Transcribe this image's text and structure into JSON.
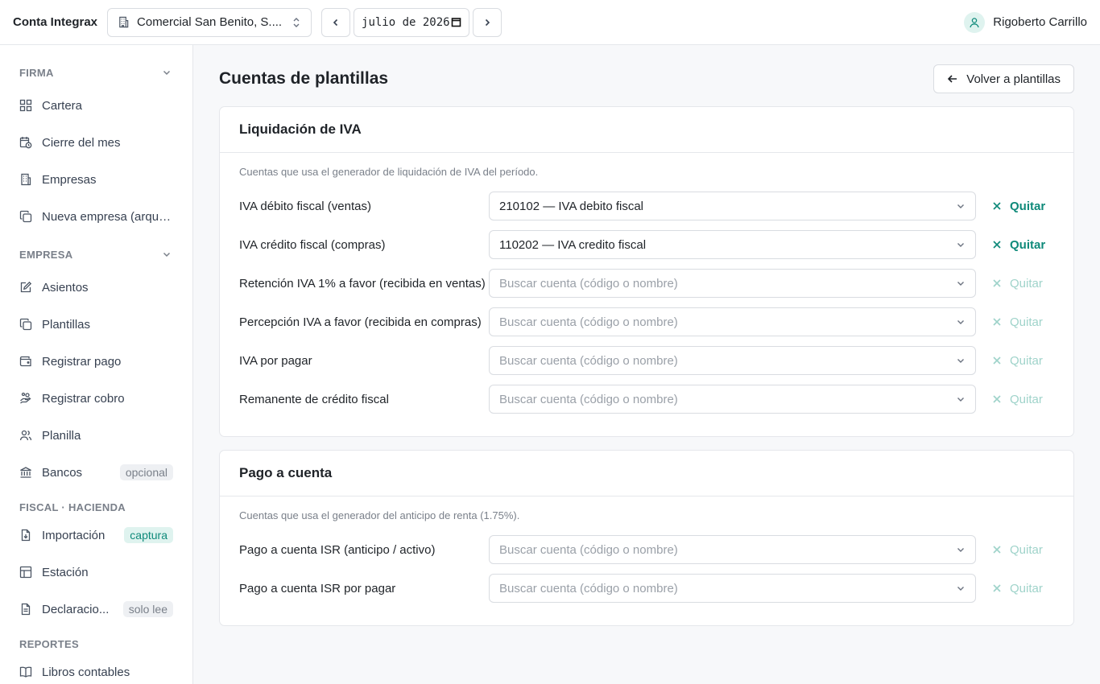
{
  "topbar": {
    "app_title": "Conta Integrax",
    "company": "Comercial San Benito, S....",
    "period": "julio de 2026",
    "user_name": "Rigoberto Carrillo"
  },
  "sidebar": {
    "sections": [
      {
        "title": "FIRMA",
        "collapsible": true,
        "items": [
          {
            "label": "Cartera",
            "icon": "grid-icon"
          },
          {
            "label": "Cierre del mes",
            "icon": "calendar-clock-icon"
          },
          {
            "label": "Empresas",
            "icon": "building-icon"
          },
          {
            "label": "Nueva empresa (arque...",
            "icon": "copy-icon"
          }
        ]
      },
      {
        "title": "EMPRESA",
        "collapsible": true,
        "items": [
          {
            "label": "Asientos",
            "icon": "edit-icon"
          },
          {
            "label": "Plantillas",
            "icon": "copy-icon"
          },
          {
            "label": "Registrar pago",
            "icon": "wallet-icon"
          },
          {
            "label": "Registrar cobro",
            "icon": "hand-coins-icon"
          },
          {
            "label": "Planilla",
            "icon": "users-icon"
          },
          {
            "label": "Bancos",
            "icon": "bank-icon",
            "badge": "opcional"
          }
        ]
      },
      {
        "title": "FISCAL · HACIENDA",
        "collapsible": false,
        "items": [
          {
            "label": "Importación",
            "icon": "file-import-icon",
            "badge": "captura",
            "badge_color": "#0f8a7a"
          },
          {
            "label": "Estación",
            "icon": "table-icon"
          },
          {
            "label": "Declaracio...",
            "icon": "file-text-icon",
            "badge": "solo lee"
          }
        ]
      },
      {
        "title": "REPORTES",
        "collapsible": false,
        "items": [
          {
            "label": "Libros contables",
            "icon": "book-icon"
          }
        ]
      }
    ]
  },
  "main": {
    "title": "Cuentas de plantillas",
    "back_label": "Volver a plantillas",
    "remove_label": "Quitar",
    "placeholder": "Buscar cuenta (código o nombre)",
    "cards": [
      {
        "title": "Liquidación de IVA",
        "description": "Cuentas que usa el generador de liquidación de IVA del período.",
        "rows": [
          {
            "label": "IVA débito fiscal (ventas)",
            "value": "210102 — IVA debito fiscal"
          },
          {
            "label": "IVA crédito fiscal (compras)",
            "value": "110202 — IVA credito fiscal"
          },
          {
            "label": "Retención IVA 1% a favor (recibida en ventas)",
            "value": ""
          },
          {
            "label": "Percepción IVA a favor (recibida en compras)",
            "value": ""
          },
          {
            "label": "IVA por pagar",
            "value": ""
          },
          {
            "label": "Remanente de crédito fiscal",
            "value": ""
          }
        ]
      },
      {
        "title": "Pago a cuenta",
        "description": "Cuentas que usa el generador del anticipo de renta (1.75%).",
        "rows": [
          {
            "label": "Pago a cuenta ISR (anticipo / activo)",
            "value": ""
          },
          {
            "label": "Pago a cuenta ISR por pagar",
            "value": ""
          }
        ]
      }
    ]
  },
  "colors": {
    "accent": "#0f8a7a",
    "accent_soft": "#dff3ef",
    "border": "#e5e7eb"
  }
}
